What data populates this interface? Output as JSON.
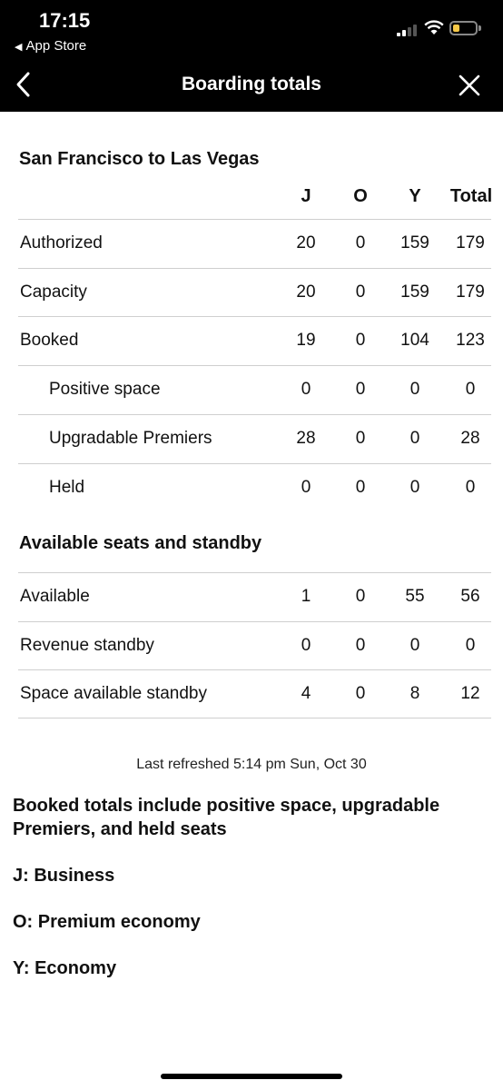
{
  "status_bar": {
    "time": "17:15",
    "back_app": "App Store"
  },
  "nav": {
    "title": "Boarding totals"
  },
  "route": {
    "title": "San Francisco to Las Vegas"
  },
  "columns": [
    "J",
    "O",
    "Y",
    "Total"
  ],
  "booking_rows": [
    {
      "label": "Authorized",
      "values": [
        "20",
        "0",
        "159",
        "179"
      ]
    },
    {
      "label": "Capacity",
      "values": [
        "20",
        "0",
        "159",
        "179"
      ]
    },
    {
      "label": "Booked",
      "values": [
        "19",
        "0",
        "104",
        "123"
      ]
    },
    {
      "label": "Positive space",
      "values": [
        "0",
        "0",
        "0",
        "0"
      ]
    },
    {
      "label": "Upgradable Premiers",
      "values": [
        "28",
        "0",
        "0",
        "28"
      ]
    },
    {
      "label": "Held",
      "values": [
        "0",
        "0",
        "0",
        "0"
      ]
    }
  ],
  "standby_section": {
    "title": "Available seats and standby"
  },
  "standby_rows": [
    {
      "label": "Available",
      "values": [
        "1",
        "0",
        "55",
        "56"
      ]
    },
    {
      "label": "Revenue standby",
      "values": [
        "0",
        "0",
        "0",
        "0"
      ]
    },
    {
      "label": "Space available standby",
      "values": [
        "4",
        "0",
        "8",
        "12"
      ]
    }
  ],
  "footer": {
    "refreshed": "Last refreshed 5:14 pm Sun, Oct 30",
    "note": "Booked totals include positive space, upgradable Premiers, and held seats",
    "legend_j": "J: Business",
    "legend_o": "O: Premium economy",
    "legend_y": "Y: Economy"
  }
}
